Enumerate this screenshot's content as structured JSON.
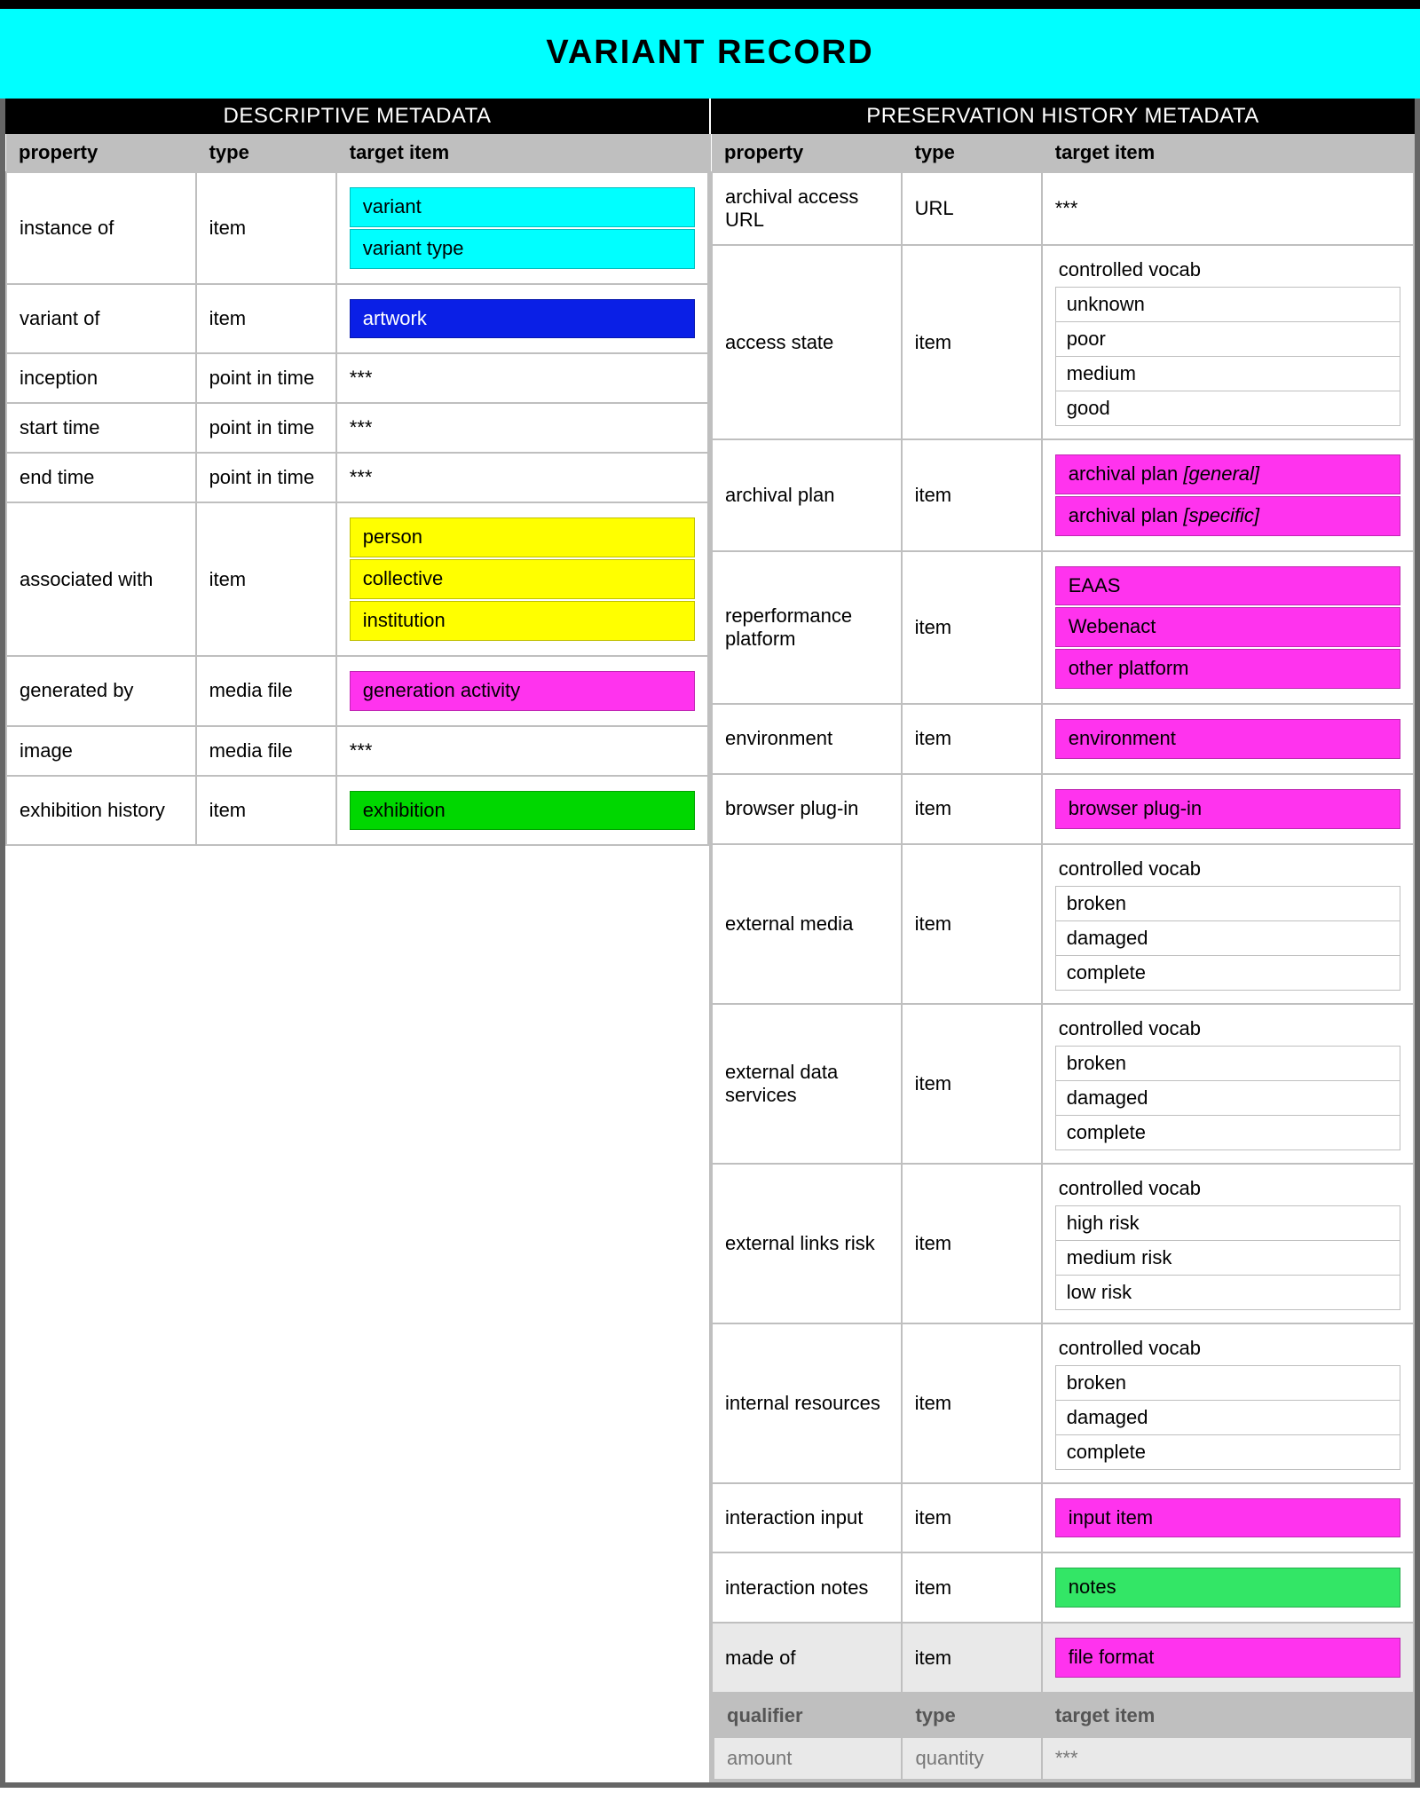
{
  "title": "VARIANT RECORD",
  "sections": {
    "desc": "DESCRIPTIVE METADATA",
    "pres": "PRESERVATION HISTORY METADATA"
  },
  "headers": {
    "prop": "property",
    "type": "type",
    "target": "target item",
    "qualifier": "qualifier"
  },
  "vocab_label": "controlled vocab",
  "stars": "***",
  "desc": {
    "instance_of": {
      "prop": "instance of",
      "type": "item",
      "tags": [
        {
          "t": "variant",
          "c": "cyan"
        },
        {
          "t": "variant type",
          "c": "cyan"
        }
      ]
    },
    "variant_of": {
      "prop": "variant of",
      "type": "item",
      "tags": [
        {
          "t": "artwork",
          "c": "blue"
        }
      ]
    },
    "inception": {
      "prop": "inception",
      "type": "point in time",
      "text": "***"
    },
    "start_time": {
      "prop": "start time",
      "type": "point in time",
      "text": "***"
    },
    "end_time": {
      "prop": "end time",
      "type": "point in time",
      "text": "***"
    },
    "associated": {
      "prop": "associated with",
      "type": "item",
      "tags": [
        {
          "t": "person",
          "c": "yellow"
        },
        {
          "t": "collective",
          "c": "yellow"
        },
        {
          "t": "institution",
          "c": "yellow"
        }
      ]
    },
    "generated_by": {
      "prop": "generated by",
      "type": "media file",
      "tags": [
        {
          "t": "generation activity",
          "c": "magenta"
        }
      ]
    },
    "image": {
      "prop": "image",
      "type": "media file",
      "text": "***"
    },
    "exhibition": {
      "prop": "exhibition history",
      "type": "item",
      "tags": [
        {
          "t": "exhibition",
          "c": "green"
        }
      ]
    }
  },
  "pres": {
    "archival_url": {
      "prop": "archival access URL",
      "type": "URL",
      "text": "***"
    },
    "access_state": {
      "prop": "access state",
      "type": "item",
      "vocab": [
        "unknown",
        "poor",
        "medium",
        "good"
      ]
    },
    "archival_plan": {
      "prop": "archival plan",
      "type": "item",
      "tags": [
        {
          "t": "archival plan ",
          "em": "[general]",
          "c": "magenta"
        },
        {
          "t": "archival plan ",
          "em": "[specific]",
          "c": "magenta"
        }
      ]
    },
    "reperf": {
      "prop": "reperformance platform",
      "type": "item",
      "tags": [
        {
          "t": "EAAS",
          "c": "magenta"
        },
        {
          "t": "Webenact",
          "c": "magenta"
        },
        {
          "t": "other platform",
          "c": "magenta"
        }
      ]
    },
    "environment": {
      "prop": "environment",
      "type": "item",
      "tags": [
        {
          "t": "environment",
          "c": "magenta"
        }
      ]
    },
    "plugin": {
      "prop": "browser plug-in",
      "type": "item",
      "tags": [
        {
          "t": "browser plug-in",
          "c": "magenta"
        }
      ]
    },
    "ext_media": {
      "prop": "external media",
      "type": "item",
      "vocab": [
        "broken",
        "damaged",
        "complete"
      ]
    },
    "ext_data": {
      "prop": "external data services",
      "type": "item",
      "vocab": [
        "broken",
        "damaged",
        "complete"
      ]
    },
    "ext_links": {
      "prop": "external links risk",
      "type": "item",
      "vocab": [
        "high risk",
        "medium risk",
        "low risk"
      ]
    },
    "int_res": {
      "prop": "internal resources",
      "type": "item",
      "vocab": [
        "broken",
        "damaged",
        "complete"
      ]
    },
    "inter_input": {
      "prop": "interaction input",
      "type": "item",
      "tags": [
        {
          "t": "input item",
          "c": "magenta"
        }
      ]
    },
    "inter_notes": {
      "prop": "interaction notes",
      "type": "item",
      "tags": [
        {
          "t": "notes",
          "c": "green2"
        }
      ]
    },
    "made_of": {
      "prop": "made of",
      "type": "item",
      "tags": [
        {
          "t": "file format",
          "c": "magenta"
        }
      ]
    },
    "qualifier": {
      "prop": "amount",
      "type": "quantity",
      "text": "***"
    }
  }
}
